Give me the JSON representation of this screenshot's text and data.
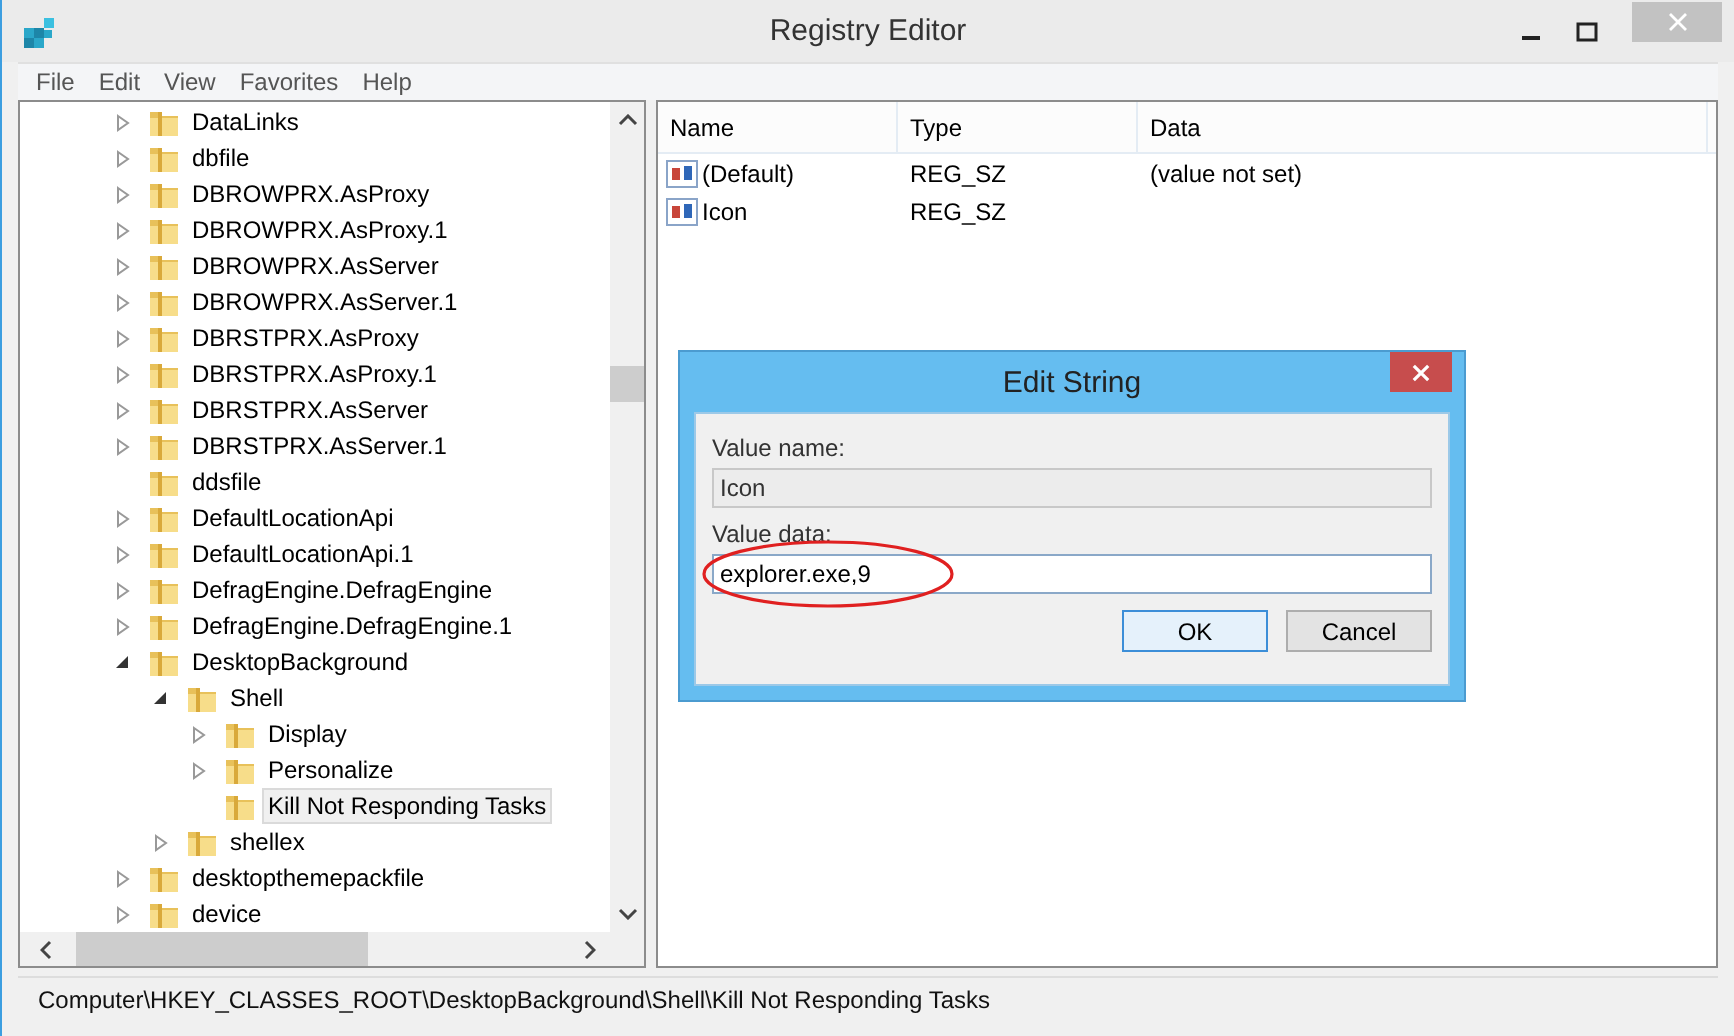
{
  "window": {
    "title": "Registry Editor"
  },
  "menu": [
    "File",
    "Edit",
    "View",
    "Favorites",
    "Help"
  ],
  "tree": [
    {
      "label": "DataLinks",
      "kind": "branch",
      "expanded": false,
      "selected": false
    },
    {
      "label": "dbfile",
      "kind": "branch",
      "expanded": false,
      "selected": false
    },
    {
      "label": "DBROWPRX.AsProxy",
      "kind": "branch",
      "expanded": false,
      "selected": false
    },
    {
      "label": "DBROWPRX.AsProxy.1",
      "kind": "branch",
      "expanded": false,
      "selected": false
    },
    {
      "label": "DBROWPRX.AsServer",
      "kind": "branch",
      "expanded": false,
      "selected": false
    },
    {
      "label": "DBROWPRX.AsServer.1",
      "kind": "branch",
      "expanded": false,
      "selected": false
    },
    {
      "label": "DBRSTPRX.AsProxy",
      "kind": "branch",
      "expanded": false,
      "selected": false
    },
    {
      "label": "DBRSTPRX.AsProxy.1",
      "kind": "branch",
      "expanded": false,
      "selected": false
    },
    {
      "label": "DBRSTPRX.AsServer",
      "kind": "branch",
      "expanded": false,
      "selected": false
    },
    {
      "label": "DBRSTPRX.AsServer.1",
      "kind": "branch",
      "expanded": false,
      "selected": false
    },
    {
      "label": "ddsfile",
      "kind": "leaf",
      "selected": false
    },
    {
      "label": "DefaultLocationApi",
      "kind": "branch",
      "expanded": false,
      "selected": false
    },
    {
      "label": "DefaultLocationApi.1",
      "kind": "branch",
      "expanded": false,
      "selected": false
    },
    {
      "label": "DefragEngine.DefragEngine",
      "kind": "branch",
      "expanded": false,
      "selected": false
    },
    {
      "label": "DefragEngine.DefragEngine.1",
      "kind": "branch",
      "expanded": false,
      "selected": false
    },
    {
      "label": "DesktopBackground",
      "kind": "branch",
      "expanded": true,
      "selected": false,
      "children": [
        {
          "label": "Shell",
          "kind": "branch",
          "expanded": true,
          "selected": false,
          "children": [
            {
              "label": "Display",
              "kind": "branch",
              "expanded": false,
              "selected": false
            },
            {
              "label": "Personalize",
              "kind": "branch",
              "expanded": false,
              "selected": false
            },
            {
              "label": "Kill Not Responding Tasks",
              "kind": "leaf",
              "selected": true
            }
          ]
        },
        {
          "label": "shellex",
          "kind": "branch",
          "expanded": false,
          "selected": false
        }
      ]
    },
    {
      "label": "desktopthemepackfile",
      "kind": "branch",
      "expanded": false,
      "selected": false
    },
    {
      "label": "device",
      "kind": "branch",
      "expanded": false,
      "selected": false
    }
  ],
  "table": {
    "columns": [
      "Name",
      "Type",
      "Data"
    ],
    "rows": [
      {
        "name": "(Default)",
        "type": "REG_SZ",
        "data": "(value not set)"
      },
      {
        "name": "Icon",
        "type": "REG_SZ"
      }
    ]
  },
  "dialog": {
    "title": "Edit String",
    "fields": [
      {
        "label": "Value name:",
        "value": "Icon",
        "readonly": true,
        "highlighted": false
      },
      {
        "label": "Value data:",
        "value": "explorer.exe,9",
        "readonly": false,
        "highlighted": true
      }
    ],
    "buttons": [
      {
        "label": "OK",
        "default": true
      },
      {
        "label": "Cancel",
        "default": false
      }
    ]
  },
  "status_bar": "Computer\\HKEY_CLASSES_ROOT\\DesktopBackground\\Shell\\Kill Not Responding Tasks"
}
